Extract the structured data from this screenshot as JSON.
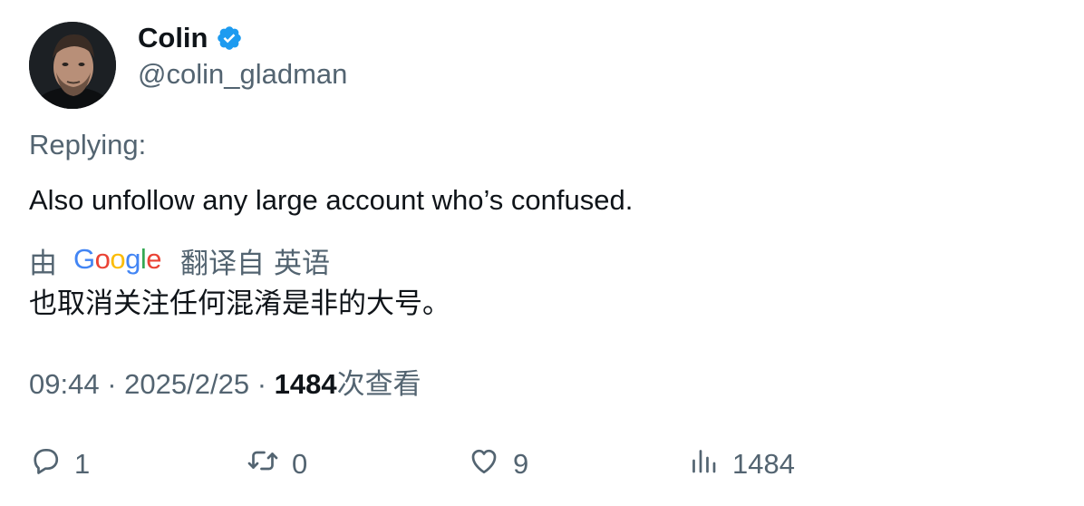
{
  "author": {
    "display_name": "Colin",
    "handle": "@colin_gladman",
    "verified_icon": "verified-badge-icon",
    "accent_color": "#1d9bf0"
  },
  "tweet": {
    "replying_label": "Replying:",
    "text": "Also unfollow any large account who’s confused."
  },
  "translation": {
    "by_label": "由",
    "google_label": "Google",
    "translated_from_label": "翻译自",
    "language": "英语",
    "text": "也取消关注任何混淆是非的大号。"
  },
  "meta": {
    "time": "09:44",
    "separator": "·",
    "date": "2025/2/25",
    "views_count": "1484",
    "views_label": "次查看"
  },
  "actions": {
    "replies": "1",
    "retweets": "0",
    "likes": "9",
    "views": "1484"
  }
}
